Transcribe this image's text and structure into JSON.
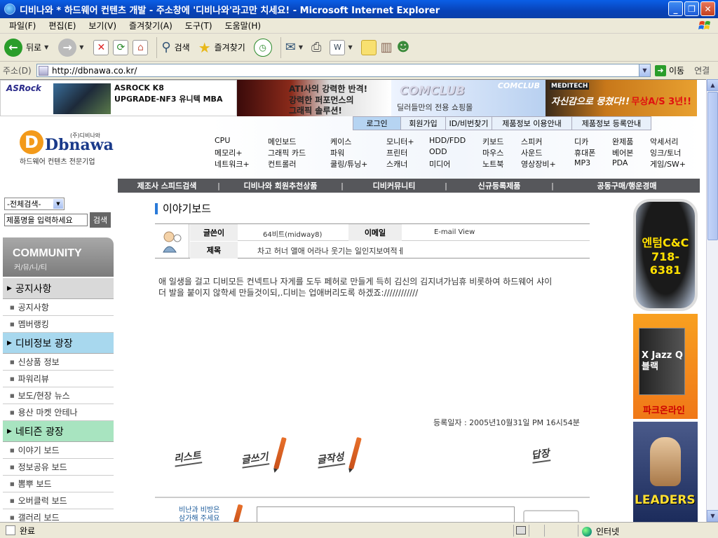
{
  "window": {
    "title": "디비나와 * 하드웨어 컨텐츠 개발 - 주소창에 '디비나와'라고만 치세요! - Microsoft Internet Explorer"
  },
  "menu": [
    "파일(F)",
    "편집(E)",
    "보기(V)",
    "즐겨찾기(A)",
    "도구(T)",
    "도움말(H)"
  ],
  "toolbar": {
    "back": "뒤로",
    "search": "검색",
    "favorites": "즐겨찾기"
  },
  "address": {
    "label": "주소(D)",
    "url": "http://dbnawa.co.kr/",
    "go": "이동",
    "links": "연결"
  },
  "banners": {
    "asrock_logo": "ASRock",
    "asrock_line1": "ASROCK K8",
    "asrock_line2": "UPGRADE-NF3 유니텍 MBA",
    "ati_line1": "ATI사의 강력한 반격!",
    "ati_line2": "강력한 퍼포먼스의",
    "ati_line3": "그래픽 솔루션!",
    "comclub": "COMCLUB",
    "comclub_sub": "딜러들만의 전용 쇼핑몰",
    "meditech": "MEDITECH",
    "meditech_slogan": "자신감으로 뭉쳤다!!",
    "meditech_as": "무상A/S 3년!!"
  },
  "topnav": [
    "로그인",
    "회원가입",
    "ID/비번찾기",
    "제품정보 이용안내",
    "제품정보 등록안내"
  ],
  "site": {
    "corp": "(주)디비나와",
    "logo": "Dbnawa",
    "tagline": "하드웨어 컨텐츠 전문기업"
  },
  "categories": [
    [
      "CPU",
      "메인보드",
      "케이스",
      "모니터+",
      "HDD/FDD",
      "키보드",
      "스피커",
      "디카",
      "완제품",
      "악세서리"
    ],
    [
      "메모리+",
      "그래픽 카드",
      "파워",
      "프린터",
      "ODD",
      "마우스",
      "사운드",
      "휴대폰",
      "베어본",
      "잉크/토너"
    ],
    [
      "네트워크+",
      "컨트롤러",
      "쿨링/튜닝+",
      "스캐너",
      "미디어",
      "노트북",
      "영상장비+",
      "MP3",
      "PDA",
      "게임/SW+"
    ]
  ],
  "mainnav": [
    "제조사 스피드검색",
    "디비나와 회원추천상품",
    "디비커뮤니티",
    "신규등록제품",
    "공동구매/행운경매"
  ],
  "left": {
    "select": "-전체검색-",
    "search_placeholder": "제품명을 입력하세요",
    "search_btn": "검색",
    "community": "COMMUNITY",
    "community_sub": "커/뮤/니/티",
    "sections": [
      {
        "title": "공지사항",
        "color": "#d9d9d9",
        "items": [
          "공지사항",
          "멤버랭킹"
        ]
      },
      {
        "title": "디비정보 광장",
        "color": "#a8d8ee",
        "items": [
          "신상품 정보",
          "파워리뷰",
          "보도/현장 뉴스",
          "용산 마켓 안테나"
        ]
      },
      {
        "title": "네티즌 광장",
        "color": "#a8e4c0",
        "items": [
          "이야기 보드",
          "정보공유 보드",
          "뽐뿌 보드",
          "오버클럭 보드",
          "갤러리 보드"
        ]
      }
    ]
  },
  "post": {
    "board_title": "이야기보드",
    "author_label": "글쓴이",
    "author": "64비트(midway8)",
    "email_label": "이메일",
    "email": "E-mail View",
    "subject_label": "제목",
    "subject": "차고 허너 앨애 어라나 웃기는 일인지보여적ㅔ",
    "body1": "애 일생을 걸고 디비모든 컨넥트나 자게를 도두 페허로 만들게 득히 김신의 김지녀가님휴 비롯하여 하드웨어 샤이",
    "body2": "더 발을 붙이지 않학세 만들것이되,.디비는 업애버리도록 하겠죠:////////////",
    "date": "등록일자 : 2005년10월31일 PM 16시54분",
    "btn_list": "리스트",
    "btn_write": "글쓰기",
    "btn_author": "글작성",
    "btn_reply": "답장",
    "comment_label1": "비난과 비방은",
    "comment_label2": "삼가해 주세요"
  },
  "ads": {
    "ad1_line1": "엔텀C&C",
    "ad1_line2": "718-6381",
    "ad2_line1": "X Jazz Q",
    "ad2_line2": "블랙",
    "ad2_brand": "파크온라인",
    "ad3": "LEADERS"
  },
  "status": {
    "text": "완료",
    "zone": "인터넷"
  }
}
